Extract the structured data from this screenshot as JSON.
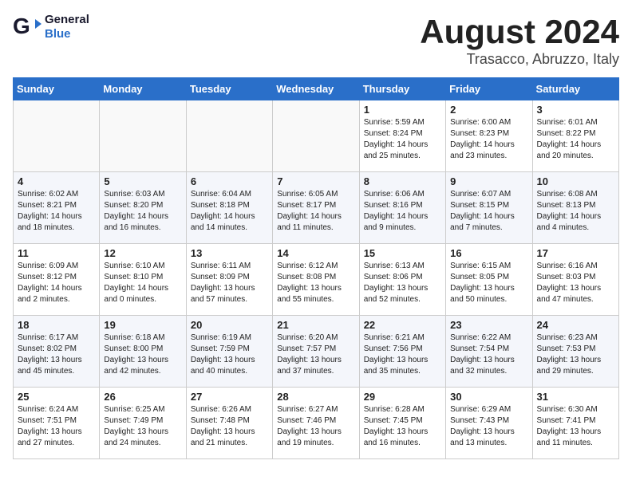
{
  "header": {
    "logo_line1": "General",
    "logo_line2": "Blue",
    "month_title": "August 2024",
    "subtitle": "Trasacco, Abruzzo, Italy"
  },
  "weekdays": [
    "Sunday",
    "Monday",
    "Tuesday",
    "Wednesday",
    "Thursday",
    "Friday",
    "Saturday"
  ],
  "weeks": [
    [
      {
        "day": "",
        "text": ""
      },
      {
        "day": "",
        "text": ""
      },
      {
        "day": "",
        "text": ""
      },
      {
        "day": "",
        "text": ""
      },
      {
        "day": "1",
        "text": "Sunrise: 5:59 AM\nSunset: 8:24 PM\nDaylight: 14 hours\nand 25 minutes."
      },
      {
        "day": "2",
        "text": "Sunrise: 6:00 AM\nSunset: 8:23 PM\nDaylight: 14 hours\nand 23 minutes."
      },
      {
        "day": "3",
        "text": "Sunrise: 6:01 AM\nSunset: 8:22 PM\nDaylight: 14 hours\nand 20 minutes."
      }
    ],
    [
      {
        "day": "4",
        "text": "Sunrise: 6:02 AM\nSunset: 8:21 PM\nDaylight: 14 hours\nand 18 minutes."
      },
      {
        "day": "5",
        "text": "Sunrise: 6:03 AM\nSunset: 8:20 PM\nDaylight: 14 hours\nand 16 minutes."
      },
      {
        "day": "6",
        "text": "Sunrise: 6:04 AM\nSunset: 8:18 PM\nDaylight: 14 hours\nand 14 minutes."
      },
      {
        "day": "7",
        "text": "Sunrise: 6:05 AM\nSunset: 8:17 PM\nDaylight: 14 hours\nand 11 minutes."
      },
      {
        "day": "8",
        "text": "Sunrise: 6:06 AM\nSunset: 8:16 PM\nDaylight: 14 hours\nand 9 minutes."
      },
      {
        "day": "9",
        "text": "Sunrise: 6:07 AM\nSunset: 8:15 PM\nDaylight: 14 hours\nand 7 minutes."
      },
      {
        "day": "10",
        "text": "Sunrise: 6:08 AM\nSunset: 8:13 PM\nDaylight: 14 hours\nand 4 minutes."
      }
    ],
    [
      {
        "day": "11",
        "text": "Sunrise: 6:09 AM\nSunset: 8:12 PM\nDaylight: 14 hours\nand 2 minutes."
      },
      {
        "day": "12",
        "text": "Sunrise: 6:10 AM\nSunset: 8:10 PM\nDaylight: 14 hours\nand 0 minutes."
      },
      {
        "day": "13",
        "text": "Sunrise: 6:11 AM\nSunset: 8:09 PM\nDaylight: 13 hours\nand 57 minutes."
      },
      {
        "day": "14",
        "text": "Sunrise: 6:12 AM\nSunset: 8:08 PM\nDaylight: 13 hours\nand 55 minutes."
      },
      {
        "day": "15",
        "text": "Sunrise: 6:13 AM\nSunset: 8:06 PM\nDaylight: 13 hours\nand 52 minutes."
      },
      {
        "day": "16",
        "text": "Sunrise: 6:15 AM\nSunset: 8:05 PM\nDaylight: 13 hours\nand 50 minutes."
      },
      {
        "day": "17",
        "text": "Sunrise: 6:16 AM\nSunset: 8:03 PM\nDaylight: 13 hours\nand 47 minutes."
      }
    ],
    [
      {
        "day": "18",
        "text": "Sunrise: 6:17 AM\nSunset: 8:02 PM\nDaylight: 13 hours\nand 45 minutes."
      },
      {
        "day": "19",
        "text": "Sunrise: 6:18 AM\nSunset: 8:00 PM\nDaylight: 13 hours\nand 42 minutes."
      },
      {
        "day": "20",
        "text": "Sunrise: 6:19 AM\nSunset: 7:59 PM\nDaylight: 13 hours\nand 40 minutes."
      },
      {
        "day": "21",
        "text": "Sunrise: 6:20 AM\nSunset: 7:57 PM\nDaylight: 13 hours\nand 37 minutes."
      },
      {
        "day": "22",
        "text": "Sunrise: 6:21 AM\nSunset: 7:56 PM\nDaylight: 13 hours\nand 35 minutes."
      },
      {
        "day": "23",
        "text": "Sunrise: 6:22 AM\nSunset: 7:54 PM\nDaylight: 13 hours\nand 32 minutes."
      },
      {
        "day": "24",
        "text": "Sunrise: 6:23 AM\nSunset: 7:53 PM\nDaylight: 13 hours\nand 29 minutes."
      }
    ],
    [
      {
        "day": "25",
        "text": "Sunrise: 6:24 AM\nSunset: 7:51 PM\nDaylight: 13 hours\nand 27 minutes."
      },
      {
        "day": "26",
        "text": "Sunrise: 6:25 AM\nSunset: 7:49 PM\nDaylight: 13 hours\nand 24 minutes."
      },
      {
        "day": "27",
        "text": "Sunrise: 6:26 AM\nSunset: 7:48 PM\nDaylight: 13 hours\nand 21 minutes."
      },
      {
        "day": "28",
        "text": "Sunrise: 6:27 AM\nSunset: 7:46 PM\nDaylight: 13 hours\nand 19 minutes."
      },
      {
        "day": "29",
        "text": "Sunrise: 6:28 AM\nSunset: 7:45 PM\nDaylight: 13 hours\nand 16 minutes."
      },
      {
        "day": "30",
        "text": "Sunrise: 6:29 AM\nSunset: 7:43 PM\nDaylight: 13 hours\nand 13 minutes."
      },
      {
        "day": "31",
        "text": "Sunrise: 6:30 AM\nSunset: 7:41 PM\nDaylight: 13 hours\nand 11 minutes."
      }
    ]
  ]
}
